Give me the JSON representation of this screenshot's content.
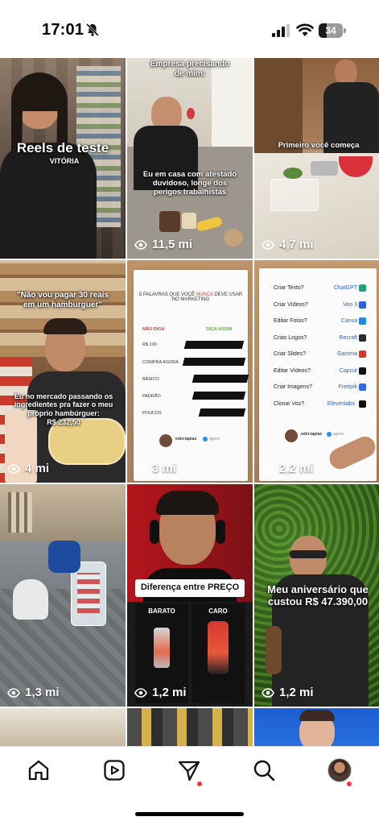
{
  "status_bar": {
    "time": "17:01",
    "battery_level": "34",
    "battery_fraction": 0.34,
    "icons": [
      "bell-slash-icon",
      "signal-icon",
      "wifi-icon",
      "battery-icon"
    ]
  },
  "grid": {
    "tiles": [
      {
        "id": 1,
        "title": "Reels de teste",
        "subtitle": "VITÓRIA",
        "views": "",
        "colors": [
          "#6a5848",
          "#2c2623"
        ]
      },
      {
        "id": 2,
        "top_caption": "Empresa precisando de mim:",
        "bottom_caption": "Eu em casa com atestado duvidoso, longe dos perigos trabalhistas",
        "views": "11,5 mi"
      },
      {
        "id": 3,
        "caption": "Primeiro você começa",
        "views": "4,7 mi"
      },
      {
        "id": 4,
        "top_caption": "\"Não vou pagar 30 reais em um hamburguer\"",
        "bottom_caption": "Eu no mercado passando os ingredientes pra fazer o meu próprio hambúrguer:",
        "price": "R$ 232,50",
        "views": "4 mi"
      },
      {
        "id": 5,
        "doc_title_a": "5 PALAVRAS QUE VOCÊ",
        "doc_title_highlight": "NUNCA",
        "doc_title_b": "DEVE USAR NO MARKETING",
        "left_header": "NÃO DIGA",
        "right_header": "DIGA ASSIM",
        "words": [
          "R$ 100",
          "COMPRA AGORA",
          "BÁSICO",
          "PADRÃO",
          "POUCOS"
        ],
        "author": "eder.tapias",
        "author_tag": "agora",
        "views": "3 mi"
      },
      {
        "id": 6,
        "rows": [
          {
            "question": "Criar Texto?",
            "tool": "ChatGPT"
          },
          {
            "question": "Criar Vídeos?",
            "tool": "Veo 3"
          },
          {
            "question": "Editar Fotos?",
            "tool": "Canva"
          },
          {
            "question": "Crias Logos?",
            "tool": "Recraft"
          },
          {
            "question": "Criar Slides?",
            "tool": "Gamma"
          },
          {
            "question": "Editar Vídeos?",
            "tool": "Capcut"
          },
          {
            "question": "Criar Imagens?",
            "tool": "Freepik"
          },
          {
            "question": "Clonar Voz?",
            "tool": "Elevenlabs"
          }
        ],
        "author": "eder.tapias",
        "author_tag": "agora",
        "views": "2,2 mi"
      },
      {
        "id": 7,
        "views": "1,3 mi"
      },
      {
        "id": 8,
        "caption": "Diferença entre PREÇO",
        "left_label": "BARATO",
        "right_label": "CARO",
        "views": "1,2 mi"
      },
      {
        "id": 9,
        "caption": "Meu aniversário que custou R$ 47.390,00",
        "views": "1,2 mi"
      }
    ]
  },
  "bottom_nav": {
    "items": [
      "home-icon",
      "reels-icon",
      "send-icon",
      "search-icon",
      "profile-avatar"
    ]
  }
}
